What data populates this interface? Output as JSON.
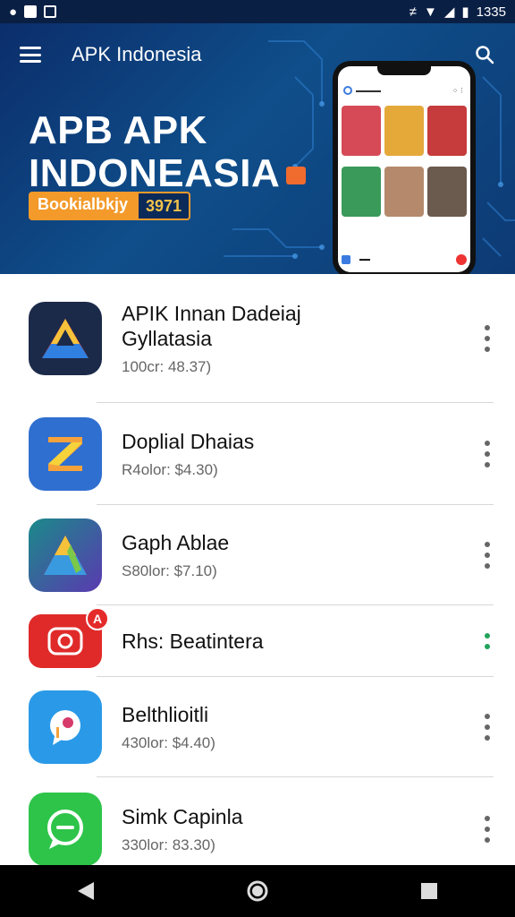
{
  "status_bar": {
    "time": "1335"
  },
  "header": {
    "title": "APK Indonesia"
  },
  "hero": {
    "title_line1": "APB APK",
    "title_line2": "INDONEASIA",
    "badge_left": "Bookialbkjy",
    "badge_right": "3971"
  },
  "apps": [
    {
      "name_line1": "APIK Innan Dadeiaj",
      "name_line2": "Gyllatasia",
      "meta": "100cr: 48.37)"
    },
    {
      "name_line1": "Doplial Dhaias",
      "name_line2": "",
      "meta": "R4olor: $4.30)"
    },
    {
      "name_line1": "Gaph Ablae",
      "name_line2": "",
      "meta": "S80lor: $7.10)"
    },
    {
      "name_line1": "Rhs: Beatintera",
      "name_line2": "",
      "meta": ""
    },
    {
      "name_line1": "Belthlioitli",
      "name_line2": "",
      "meta": "430lor: $4.40)"
    },
    {
      "name_line1": "Simk Capinla",
      "name_line2": "",
      "meta": "330lor: 83.30)"
    }
  ],
  "colors": {
    "hero_bg": "#0f4e8a",
    "badge_orange": "#f39a2b",
    "kebab_green": "#21a35a"
  }
}
